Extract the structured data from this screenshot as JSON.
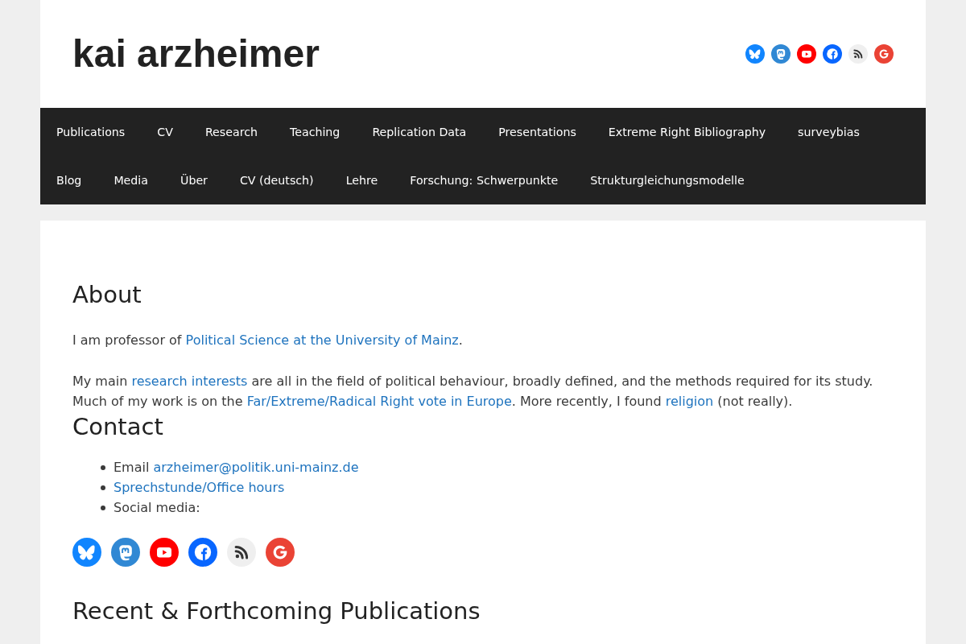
{
  "site_title": "kai arzheimer",
  "header_social": [
    {
      "kind": "bluesky"
    },
    {
      "kind": "mastodon"
    },
    {
      "kind": "youtube"
    },
    {
      "kind": "facebook"
    },
    {
      "kind": "rss"
    },
    {
      "kind": "google"
    }
  ],
  "main_menu": {
    "items": [
      "Publications",
      "CV",
      "Research",
      "Teaching",
      "Replication Data",
      "Presentations",
      "Extreme Right Bibliography",
      "surveybias",
      "Blog",
      "Media",
      "Über",
      "CV (deutsch)",
      "Lehre",
      "Forschung: Schwerpunkte",
      "Strukturgleichungsmodelle"
    ]
  },
  "sections": [
    {
      "heading": "About",
      "paragraphs": [
        [
          {
            "kind": "text",
            "text": "I am professor of "
          },
          {
            "kind": "link",
            "text": "Political Science at the University of Mainz"
          },
          {
            "kind": "text",
            "text": "."
          }
        ],
        [
          {
            "kind": "text",
            "text": "My main "
          },
          {
            "kind": "link",
            "text": "research interests"
          },
          {
            "kind": "text",
            "text": " are all in the field of political behaviour, broadly defined, and the methods required for its study. Much of my work is on the "
          },
          {
            "kind": "link",
            "text": "Far/Extreme/Radical Right vote in Europe"
          },
          {
            "kind": "text",
            "text": ". More recently, I found "
          },
          {
            "kind": "link",
            "text": "religion"
          },
          {
            "kind": "text",
            "text": " (not really)."
          }
        ]
      ]
    },
    {
      "heading": "Contact",
      "list": [
        [
          {
            "kind": "text",
            "text": "Email "
          },
          {
            "kind": "link",
            "text": "arzheimer@politik.uni-mainz.de"
          }
        ],
        [
          {
            "kind": "link",
            "text": "Sprechstunde/Office hours"
          }
        ],
        [
          {
            "kind": "text",
            "text": "Social media:"
          }
        ]
      ],
      "social": [
        {
          "kind": "bluesky"
        },
        {
          "kind": "mastodon"
        },
        {
          "kind": "youtube"
        },
        {
          "kind": "facebook"
        },
        {
          "kind": "rss"
        },
        {
          "kind": "google"
        }
      ]
    },
    {
      "heading": "Recent & Forthcoming Publications"
    }
  ]
}
